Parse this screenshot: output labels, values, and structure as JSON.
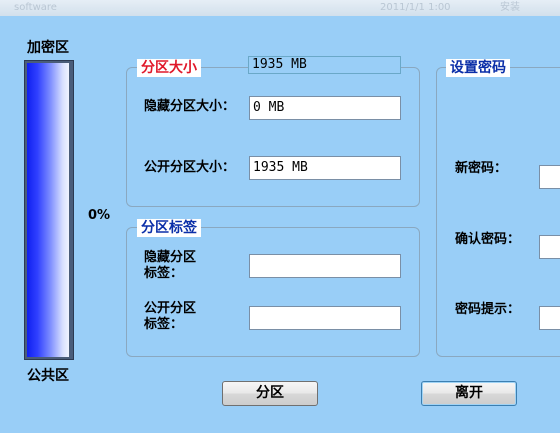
{
  "titlebar": {
    "app_name": "software",
    "date": "2011/1/1 1:00",
    "mode": "安装"
  },
  "indicator": {
    "top_label": "加密区",
    "bottom_label": "公共区",
    "percent_text": "0%",
    "fill_fraction": 1.0
  },
  "size_group": {
    "legend": "分区大小",
    "total_display": "1935 MB",
    "hidden_label": "隐藏分区大小：",
    "hidden_value": "0 MB",
    "public_label": "公开分区大小：",
    "public_value": "1935 MB"
  },
  "label_group": {
    "legend": "分区标签",
    "hidden_label_line1": "隐藏分区",
    "hidden_label_line2": "标签：",
    "hidden_value": "",
    "public_label_line1": "公开分区",
    "public_label_line2": "标签：",
    "public_value": ""
  },
  "password_group": {
    "legend": "设置密码",
    "new_password_label": "新密码：",
    "confirm_password_label": "确认密码：",
    "hint_label": "密码提示："
  },
  "buttons": {
    "partition": "分区",
    "exit": "离开"
  }
}
